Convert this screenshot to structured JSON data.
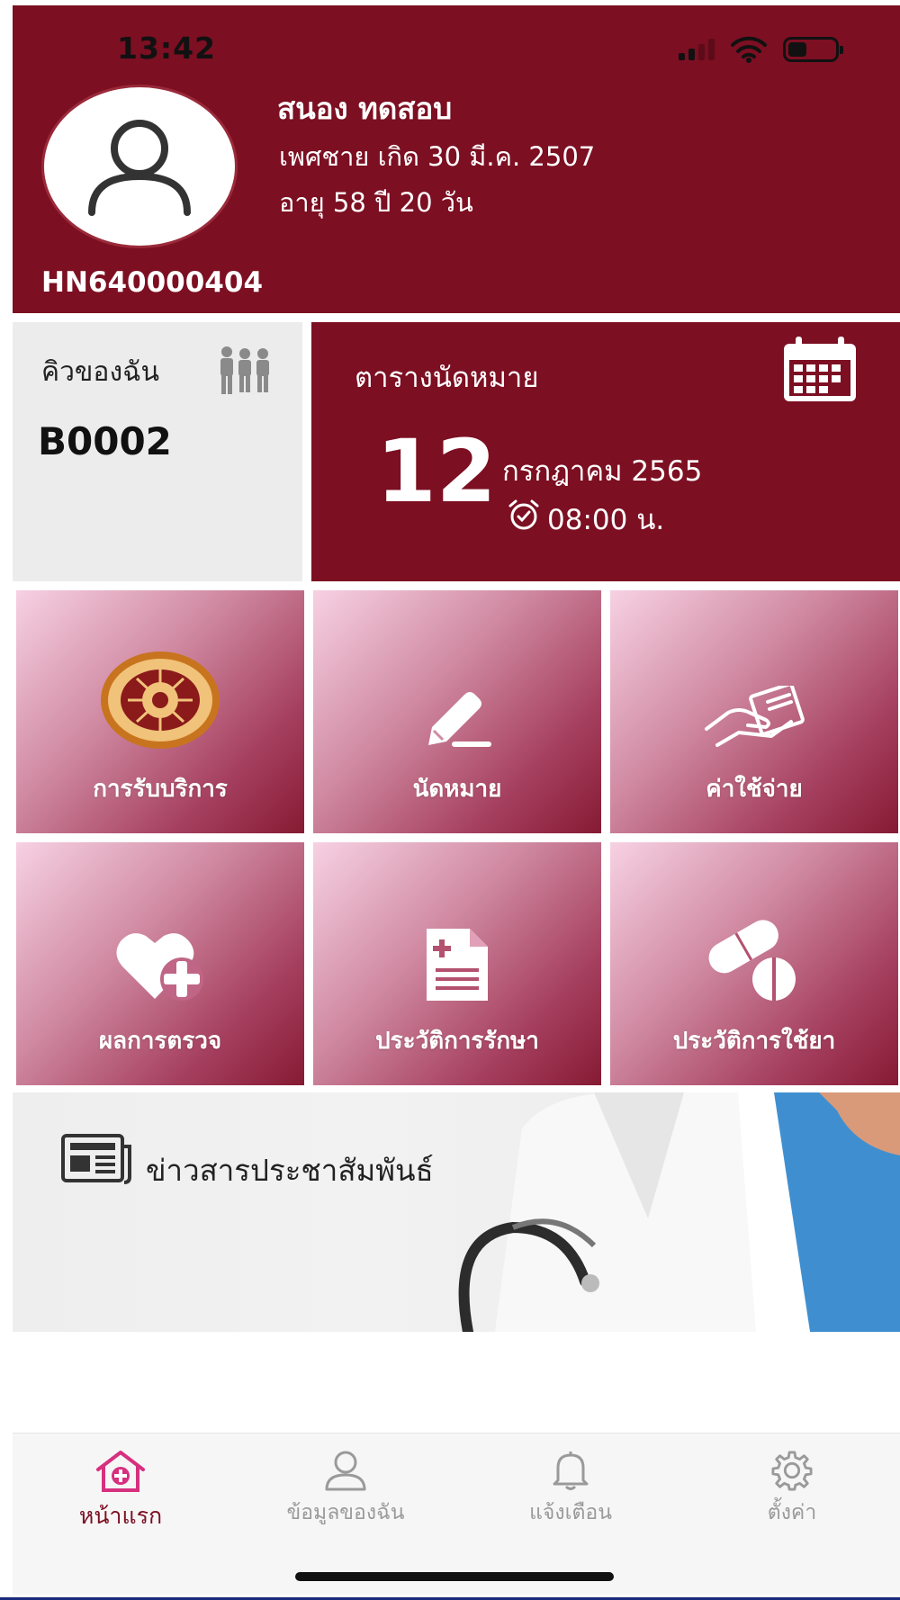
{
  "status_bar": {
    "time": "13:42"
  },
  "profile": {
    "name": "สนอง  ทดสอบ",
    "gender_dob": "เพศชาย เกิด 30 มี.ค. 2507",
    "age": "อายุ 58 ปี 20 วัน",
    "hn": "HN640000404"
  },
  "queue": {
    "label": "คิวของฉัน",
    "number": "B0002",
    "icon": "people-queue-icon"
  },
  "appointment": {
    "title": "ตารางนัดหมาย",
    "day": "12",
    "month_year": "กรกฎาคม 2565",
    "time": "08:00 น.",
    "icon": "calendar-icon"
  },
  "menu": [
    {
      "label": "การรับบริการ",
      "icon": "hospital-seal-icon"
    },
    {
      "label": "นัดหมาย",
      "icon": "pencil-sign-icon"
    },
    {
      "label": "ค่าใช้จ่าย",
      "icon": "hand-receipt-icon"
    },
    {
      "label": "ผลการตรวจ",
      "icon": "heart-plus-icon"
    },
    {
      "label": "ประวัติการรักษา",
      "icon": "medical-record-icon"
    },
    {
      "label": "ประวัติการใช้ยา",
      "icon": "pills-icon"
    }
  ],
  "news": {
    "label": "ข่าวสารประชาสัมพันธ์",
    "icon": "newspaper-icon"
  },
  "tabs": [
    {
      "label": "หน้าแรก",
      "icon": "home-medical-icon",
      "active": true
    },
    {
      "label": "ข้อมูลของฉัน",
      "icon": "user-icon",
      "active": false
    },
    {
      "label": "แจ้งเตือน",
      "icon": "bell-icon",
      "active": false
    },
    {
      "label": "ตั้งค่า",
      "icon": "gear-icon",
      "active": false
    }
  ],
  "colors": {
    "brand": "#7c0f22",
    "tile_light": "#f7d1e3",
    "tab_inactive": "#9a9a9a"
  }
}
